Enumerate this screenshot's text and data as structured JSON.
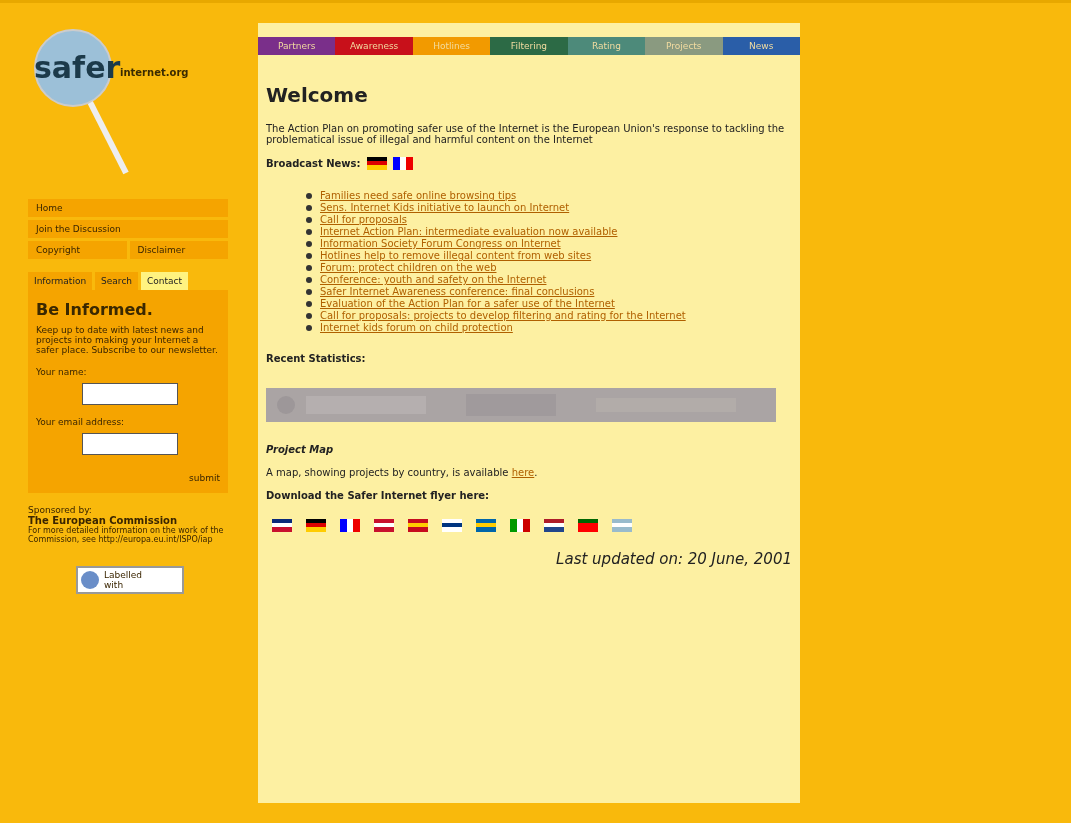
{
  "logo": {
    "word": "safer",
    "domain": "internet.org"
  },
  "side_menu": [
    "Home",
    "Join the Discussion",
    "Copyright",
    "Disclaimer"
  ],
  "side_tabs": [
    {
      "label": "Information",
      "selected": false
    },
    {
      "label": "Search",
      "selected": false
    },
    {
      "label": "Contact",
      "selected": true
    }
  ],
  "newsletter": {
    "title": "Be Informed.",
    "text": "Keep up to date with latest news and projects into making your Internet a safer place. Subscribe to our newsletter.",
    "fields": [
      {
        "label": "Your name:"
      },
      {
        "label": "Your email address:"
      }
    ],
    "submit": "submit"
  },
  "sponsor": {
    "caption": "Sponsored by:",
    "name": "The European Commission",
    "note": "For more detailed information on the work of the Commission, see http://europa.eu.int/ISPO/iap"
  },
  "badge": {
    "line1": "Labelled",
    "line2": "with"
  },
  "nav_tabs": [
    {
      "label": "Partners",
      "color": "#7a2f8a"
    },
    {
      "label": "Awareness",
      "color": "#c8101a"
    },
    {
      "label": "Hotlines",
      "color": "#f29a00"
    },
    {
      "label": "Filtering",
      "color": "#2c6a45"
    },
    {
      "label": "Rating",
      "color": "#4d8a7a"
    },
    {
      "label": "Projects",
      "color": "#8a9a80"
    },
    {
      "label": "News",
      "color": "#2a5ea8"
    }
  ],
  "title": "Welcome",
  "intro": "The Action Plan on promoting safer use of the Internet is the European Union's response to tackling the problematical issue of illegal and harmful content on the Internet",
  "news_label": "Broadcast News:",
  "news": [
    "Families need safe online browsing tips",
    "Sens. Internet Kids initiative to launch on Internet",
    "Call for proposals",
    "Internet Action Plan: intermediate evaluation now available",
    "Information Society Forum Congress on Internet",
    "Hotlines help to remove illegal content from web sites",
    "Forum: protect children on the web",
    "Conference: youth and safety on the Internet",
    "Safer Internet Awareness conference: final conclusions",
    "Evaluation of the Action Plan for a safer use of the Internet",
    "Call for proposals: projects to develop filtering and rating for the Internet",
    "Internet kids forum on child protection"
  ],
  "stats_label": "Recent Statistics:",
  "map": {
    "label": "Project Map",
    "text": "A map, showing projects by country, is available ",
    "link": "here",
    "end": "."
  },
  "flyer_label": "Download the Safer Internet flyer here:",
  "updated": "Last updated on: 20 June, 2001"
}
